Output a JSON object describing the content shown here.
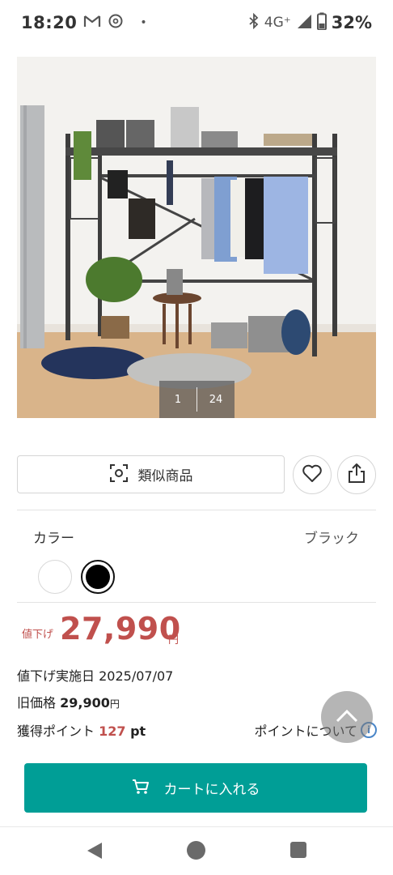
{
  "status_bar": {
    "time": "18:20",
    "icons": [
      "gmail-icon",
      "threads-icon"
    ],
    "dot": "•",
    "network": "4G⁺",
    "battery": "32%"
  },
  "gallery": {
    "current": "1",
    "total": "24"
  },
  "actions": {
    "similar_label": "類似商品",
    "favorite_icon": "heart-icon",
    "share_icon": "share-icon"
  },
  "color": {
    "label": "カラー",
    "selected": "ブラック",
    "options": [
      "white",
      "black"
    ]
  },
  "price": {
    "discount_tag": "値下げ",
    "value": "27,990",
    "yen": "円",
    "markdown_date_label": "値下げ実施日 ",
    "markdown_date": "2025/07/07",
    "old_price_label": "旧価格 ",
    "old_price": "29,900",
    "old_price_yen": "円"
  },
  "points": {
    "label": "獲得ポイント ",
    "value": "127",
    "unit": " pt",
    "about_link": "ポイントについて",
    "about_icon": "i"
  },
  "cart": {
    "label": "カートに入れる"
  },
  "colors": {
    "accent": "#009e96",
    "price": "#c0504d"
  }
}
